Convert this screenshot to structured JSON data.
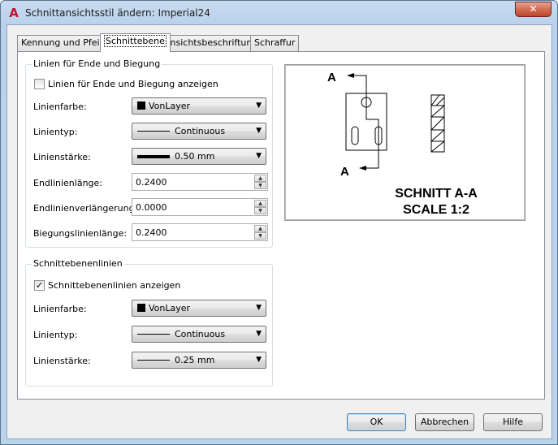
{
  "window": {
    "title": "Schnittansichtsstil ändern: Imperial24",
    "app_icon": "autocad-a-icon",
    "close_label": "✕"
  },
  "tabs": [
    {
      "label": "Kennung und Pfeile"
    },
    {
      "label": "Schnittebene"
    },
    {
      "label": "Ansichtsbeschriftung"
    },
    {
      "label": "Schraffur"
    }
  ],
  "end_bend": {
    "title": "Linien für Ende und Biegung",
    "show_label": "Linien für Ende und Biegung anzeigen",
    "show_checked": false,
    "color_label": "Linienfarbe:",
    "color_value": "VonLayer",
    "linetype_label": "Linientyp:",
    "linetype_value": "Continuous",
    "lineweight_label": "Linienstärke:",
    "lineweight_value": "0.50 mm",
    "end_length_label": "Endlinienlänge:",
    "end_length_value": "0.2400",
    "end_ext_label": "Endlinienverlängerung:",
    "end_ext_value": "0.0000",
    "bend_length_label": "Biegungslinienlänge:",
    "bend_length_value": "0.2400"
  },
  "plane_lines": {
    "title": "Schnittebenenlinien",
    "show_label": "Schnittebenenlinien anzeigen",
    "show_checked": true,
    "color_label": "Linienfarbe:",
    "color_value": "VonLayer",
    "linetype_label": "Linientyp:",
    "linetype_value": "Continuous",
    "lineweight_label": "Linienstärke:",
    "lineweight_value": "0.25 mm"
  },
  "preview": {
    "marker_top": "A",
    "marker_bottom": "A",
    "caption_line1": "SCHNITT A-A",
    "caption_line2": "SCALE 1:2"
  },
  "buttons": {
    "ok": "OK",
    "cancel": "Abbrechen",
    "help": "Hilfe"
  }
}
